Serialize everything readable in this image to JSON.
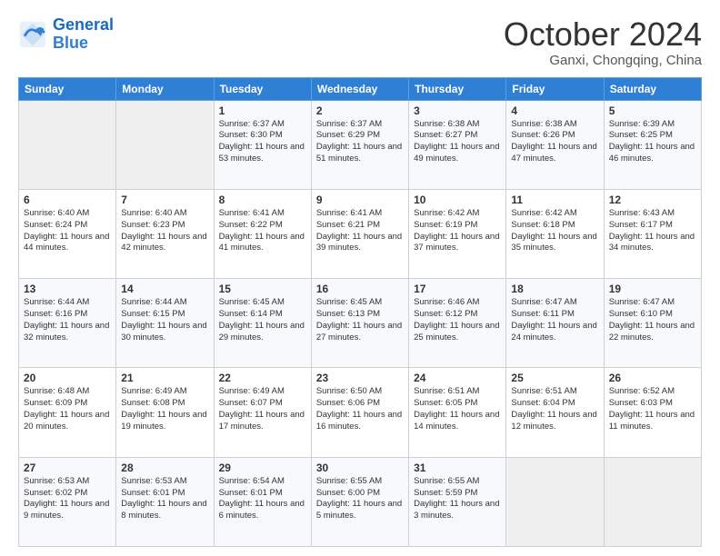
{
  "header": {
    "logo_line1": "General",
    "logo_line2": "Blue",
    "month": "October 2024",
    "location": "Ganxi, Chongqing, China"
  },
  "weekdays": [
    "Sunday",
    "Monday",
    "Tuesday",
    "Wednesday",
    "Thursday",
    "Friday",
    "Saturday"
  ],
  "weeks": [
    [
      {
        "day": "",
        "text": ""
      },
      {
        "day": "",
        "text": ""
      },
      {
        "day": "1",
        "text": "Sunrise: 6:37 AM\nSunset: 6:30 PM\nDaylight: 11 hours and 53 minutes."
      },
      {
        "day": "2",
        "text": "Sunrise: 6:37 AM\nSunset: 6:29 PM\nDaylight: 11 hours and 51 minutes."
      },
      {
        "day": "3",
        "text": "Sunrise: 6:38 AM\nSunset: 6:27 PM\nDaylight: 11 hours and 49 minutes."
      },
      {
        "day": "4",
        "text": "Sunrise: 6:38 AM\nSunset: 6:26 PM\nDaylight: 11 hours and 47 minutes."
      },
      {
        "day": "5",
        "text": "Sunrise: 6:39 AM\nSunset: 6:25 PM\nDaylight: 11 hours and 46 minutes."
      }
    ],
    [
      {
        "day": "6",
        "text": "Sunrise: 6:40 AM\nSunset: 6:24 PM\nDaylight: 11 hours and 44 minutes."
      },
      {
        "day": "7",
        "text": "Sunrise: 6:40 AM\nSunset: 6:23 PM\nDaylight: 11 hours and 42 minutes."
      },
      {
        "day": "8",
        "text": "Sunrise: 6:41 AM\nSunset: 6:22 PM\nDaylight: 11 hours and 41 minutes."
      },
      {
        "day": "9",
        "text": "Sunrise: 6:41 AM\nSunset: 6:21 PM\nDaylight: 11 hours and 39 minutes."
      },
      {
        "day": "10",
        "text": "Sunrise: 6:42 AM\nSunset: 6:19 PM\nDaylight: 11 hours and 37 minutes."
      },
      {
        "day": "11",
        "text": "Sunrise: 6:42 AM\nSunset: 6:18 PM\nDaylight: 11 hours and 35 minutes."
      },
      {
        "day": "12",
        "text": "Sunrise: 6:43 AM\nSunset: 6:17 PM\nDaylight: 11 hours and 34 minutes."
      }
    ],
    [
      {
        "day": "13",
        "text": "Sunrise: 6:44 AM\nSunset: 6:16 PM\nDaylight: 11 hours and 32 minutes."
      },
      {
        "day": "14",
        "text": "Sunrise: 6:44 AM\nSunset: 6:15 PM\nDaylight: 11 hours and 30 minutes."
      },
      {
        "day": "15",
        "text": "Sunrise: 6:45 AM\nSunset: 6:14 PM\nDaylight: 11 hours and 29 minutes."
      },
      {
        "day": "16",
        "text": "Sunrise: 6:45 AM\nSunset: 6:13 PM\nDaylight: 11 hours and 27 minutes."
      },
      {
        "day": "17",
        "text": "Sunrise: 6:46 AM\nSunset: 6:12 PM\nDaylight: 11 hours and 25 minutes."
      },
      {
        "day": "18",
        "text": "Sunrise: 6:47 AM\nSunset: 6:11 PM\nDaylight: 11 hours and 24 minutes."
      },
      {
        "day": "19",
        "text": "Sunrise: 6:47 AM\nSunset: 6:10 PM\nDaylight: 11 hours and 22 minutes."
      }
    ],
    [
      {
        "day": "20",
        "text": "Sunrise: 6:48 AM\nSunset: 6:09 PM\nDaylight: 11 hours and 20 minutes."
      },
      {
        "day": "21",
        "text": "Sunrise: 6:49 AM\nSunset: 6:08 PM\nDaylight: 11 hours and 19 minutes."
      },
      {
        "day": "22",
        "text": "Sunrise: 6:49 AM\nSunset: 6:07 PM\nDaylight: 11 hours and 17 minutes."
      },
      {
        "day": "23",
        "text": "Sunrise: 6:50 AM\nSunset: 6:06 PM\nDaylight: 11 hours and 16 minutes."
      },
      {
        "day": "24",
        "text": "Sunrise: 6:51 AM\nSunset: 6:05 PM\nDaylight: 11 hours and 14 minutes."
      },
      {
        "day": "25",
        "text": "Sunrise: 6:51 AM\nSunset: 6:04 PM\nDaylight: 11 hours and 12 minutes."
      },
      {
        "day": "26",
        "text": "Sunrise: 6:52 AM\nSunset: 6:03 PM\nDaylight: 11 hours and 11 minutes."
      }
    ],
    [
      {
        "day": "27",
        "text": "Sunrise: 6:53 AM\nSunset: 6:02 PM\nDaylight: 11 hours and 9 minutes."
      },
      {
        "day": "28",
        "text": "Sunrise: 6:53 AM\nSunset: 6:01 PM\nDaylight: 11 hours and 8 minutes."
      },
      {
        "day": "29",
        "text": "Sunrise: 6:54 AM\nSunset: 6:01 PM\nDaylight: 11 hours and 6 minutes."
      },
      {
        "day": "30",
        "text": "Sunrise: 6:55 AM\nSunset: 6:00 PM\nDaylight: 11 hours and 5 minutes."
      },
      {
        "day": "31",
        "text": "Sunrise: 6:55 AM\nSunset: 5:59 PM\nDaylight: 11 hours and 3 minutes."
      },
      {
        "day": "",
        "text": ""
      },
      {
        "day": "",
        "text": ""
      }
    ]
  ]
}
